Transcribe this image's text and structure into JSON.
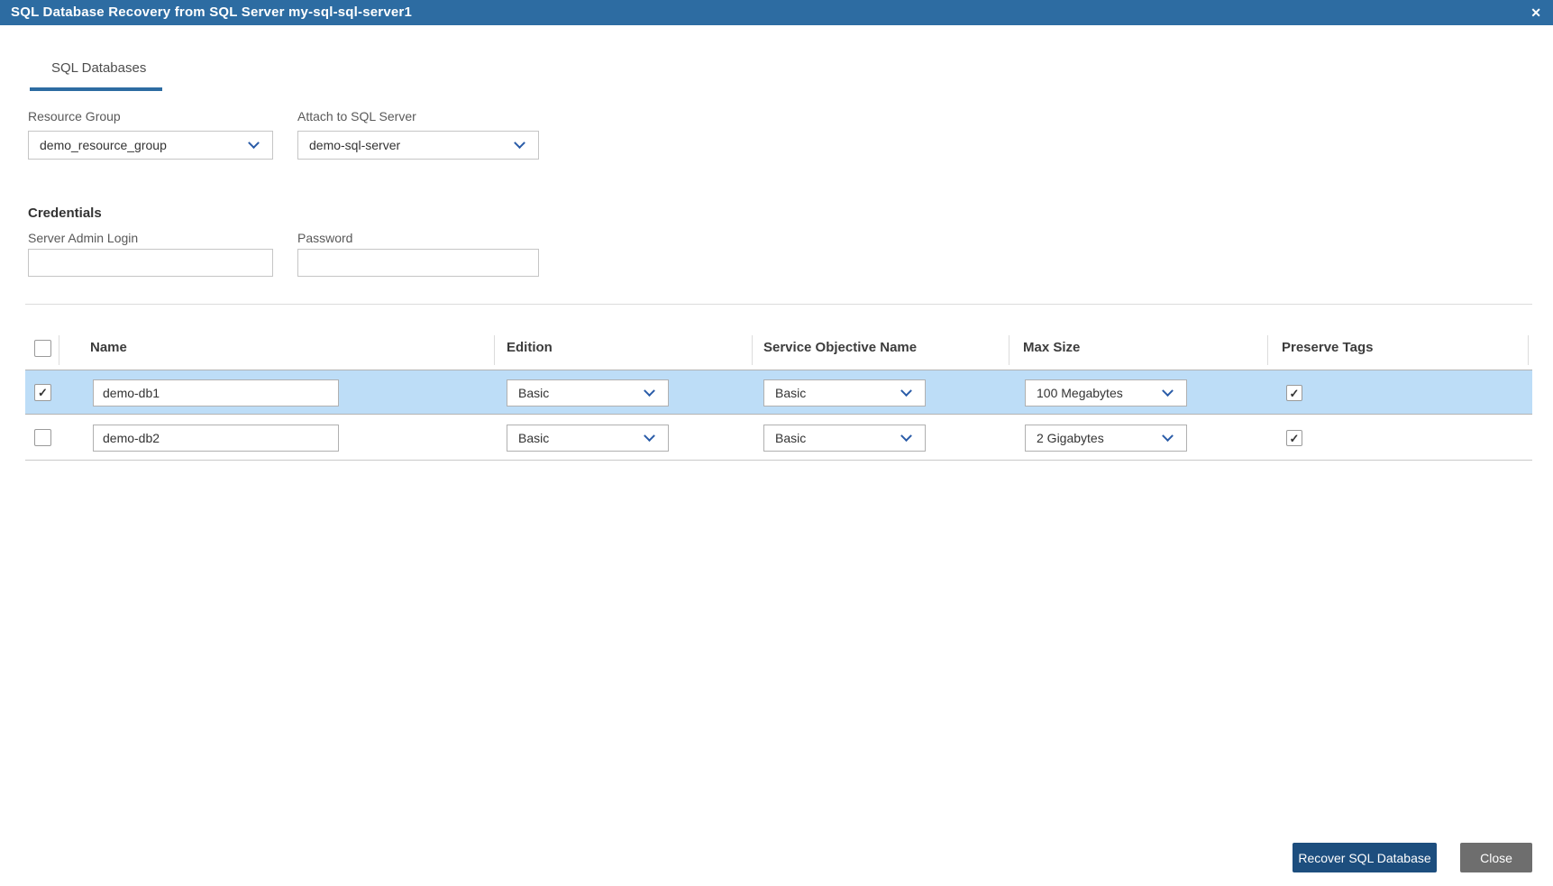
{
  "titlebar": {
    "title": "SQL Database Recovery from SQL Server my-sql-sql-server1"
  },
  "glyphs": {
    "close": "✕",
    "check": "✓"
  },
  "tabs": [
    {
      "label": "SQL Databases",
      "active": true
    }
  ],
  "form": {
    "resource_group": {
      "label": "Resource Group",
      "value": "demo_resource_group"
    },
    "attach_server": {
      "label": "Attach to SQL Server",
      "value": "demo-sql-server"
    },
    "credentials_heading": "Credentials",
    "server_admin_login": {
      "label": "Server Admin Login",
      "value": ""
    },
    "password": {
      "label": "Password",
      "value": ""
    }
  },
  "table": {
    "columns": [
      "Name",
      "Edition",
      "Service Objective Name",
      "Max Size",
      "Preserve Tags"
    ],
    "select_all_checked": false,
    "rows": [
      {
        "selected": true,
        "name": "demo-db1",
        "edition": "Basic",
        "service_objective": "Basic",
        "max_size": "100 Megabytes",
        "preserve_tags": true
      },
      {
        "selected": false,
        "name": "demo-db2",
        "edition": "Basic",
        "service_objective": "Basic",
        "max_size": "2 Gigabytes",
        "preserve_tags": true
      }
    ]
  },
  "footer": {
    "recover_label": "Recover SQL Database",
    "close_label": "Close"
  },
  "colors": {
    "titlebar": "#2d6ca2",
    "tab_accent": "#2d6ca2",
    "row_highlight": "#bdddf7",
    "primary_button": "#1d4e7e",
    "secondary_button": "#6e6e6e"
  }
}
